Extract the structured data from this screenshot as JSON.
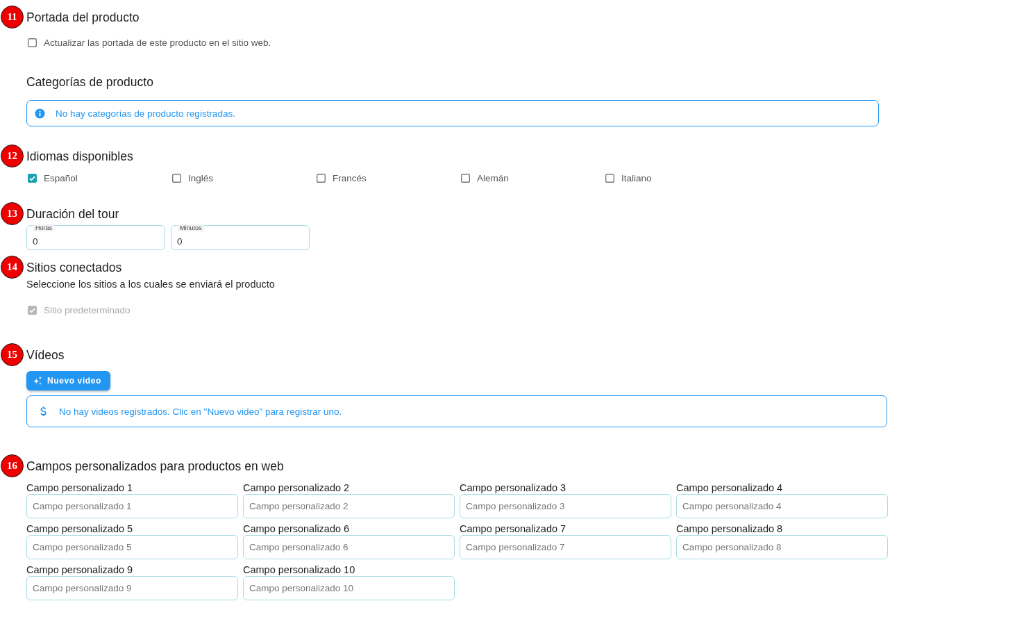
{
  "cover": {
    "marker": "11",
    "title": "Portada del producto",
    "options": [
      {
        "label": "Actualizar las portada de este producto en el sitio web.",
        "checked": false
      }
    ]
  },
  "categories": {
    "title": "Categorías de producto",
    "alert": "No hay categorías de producto registradas."
  },
  "languages": {
    "marker": "12",
    "title": "Idiomas disponibles",
    "options": [
      {
        "label": "Español",
        "checked": true
      },
      {
        "label": "Inglés",
        "checked": false
      },
      {
        "label": "Francés",
        "checked": false
      },
      {
        "label": "Alemán",
        "checked": false
      },
      {
        "label": "Italiano",
        "checked": false
      }
    ]
  },
  "tour_duration": {
    "marker": "13",
    "title": "Duración del tour",
    "fields": [
      {
        "label": "Horas",
        "value": "0"
      },
      {
        "label": "Minutos",
        "value": "0"
      }
    ]
  },
  "connected_sites": {
    "marker": "14",
    "title": "Sitios conectados",
    "subtitle": "Seleccione los sitios a los cuales se enviará el producto",
    "options": [
      {
        "label": "Sitio predeterminado",
        "checked": true,
        "disabled": true
      }
    ]
  },
  "videos": {
    "marker": "15",
    "title": "Vídeos",
    "button": "Nuevo video",
    "alert": "No hay videos registrados. Clic en \"Nuevo video\" para registrar uno."
  },
  "custom_fields": {
    "marker": "16",
    "title": "Campos personalizados para productos en web",
    "fields": [
      {
        "label": "Campo personalizado 1",
        "placeholder": "Campo personalizado 1"
      },
      {
        "label": "Campo personalizado 2",
        "placeholder": "Campo personalizado 2"
      },
      {
        "label": "Campo personalizado 3",
        "placeholder": "Campo personalizado 3"
      },
      {
        "label": "Campo personalizado 4",
        "placeholder": "Campo personalizado 4"
      },
      {
        "label": "Campo personalizado 5",
        "placeholder": "Campo personalizado 5"
      },
      {
        "label": "Campo personalizado 6",
        "placeholder": "Campo personalizado 6"
      },
      {
        "label": "Campo personalizado 7",
        "placeholder": "Campo personalizado 7"
      },
      {
        "label": "Campo personalizado 8",
        "placeholder": "Campo personalizado 8"
      },
      {
        "label": "Campo personalizado 9",
        "placeholder": "Campo personalizado 9"
      },
      {
        "label": "Campo personalizado 10",
        "placeholder": "Campo personalizado 10"
      }
    ]
  }
}
